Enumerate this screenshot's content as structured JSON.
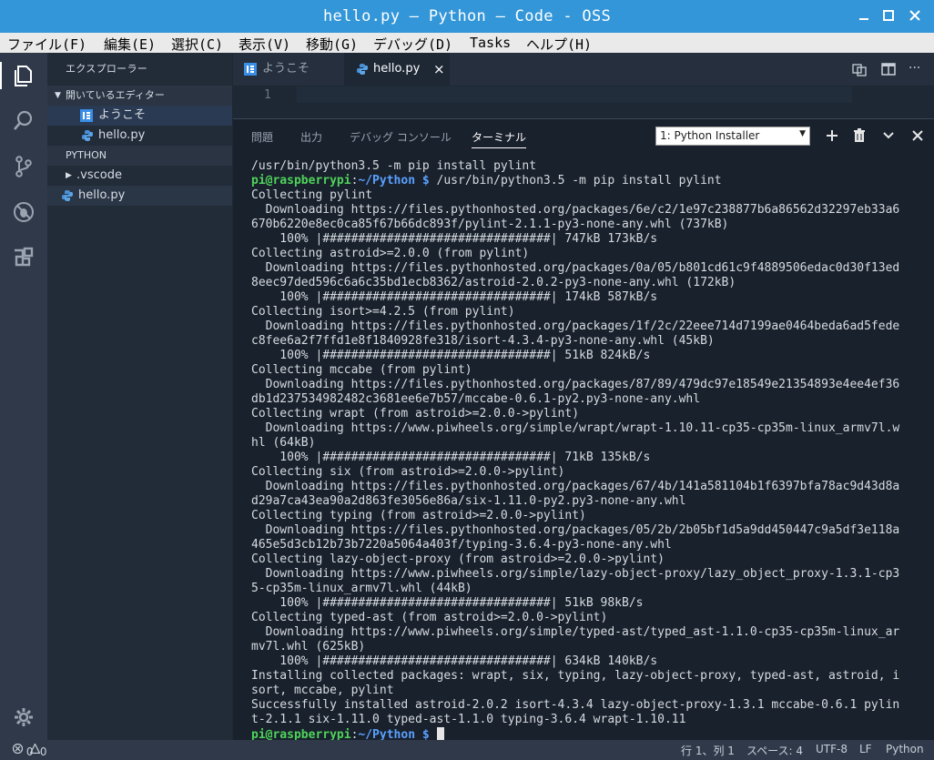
{
  "window": {
    "title": "hello.py — Python — Code - OSS"
  },
  "menu": [
    "ファイル(F)",
    "編集(E)",
    "選択(C)",
    "表示(V)",
    "移動(G)",
    "デバッグ(D)",
    "Tasks",
    "ヘルプ(H)"
  ],
  "sidebar": {
    "title": "エクスプローラー",
    "open_editors_header": "開いているエディター",
    "open_editors": [
      "ようこそ",
      "hello.py"
    ],
    "folder_header": "PYTHON",
    "files": [
      ".vscode",
      "hello.py"
    ]
  },
  "tabs": [
    {
      "label": "ようこそ"
    },
    {
      "label": "hello.py",
      "close": "×"
    }
  ],
  "editor": {
    "line_number": "1"
  },
  "panel": {
    "tabs": [
      "問題",
      "出力",
      "デバッグ コンソール",
      "ターミナル"
    ],
    "terminal_select": "1: Python Installer"
  },
  "terminal": {
    "first_line": "/usr/bin/python3.5 -m pip install pylint",
    "prompt_user": "pi@raspberrypi",
    "prompt_sep": ":",
    "prompt_path": "~/Python $",
    "command": " /usr/bin/python3.5 -m pip install pylint",
    "output": "Collecting pylint\n  Downloading https://files.pythonhosted.org/packages/6e/c2/1e97c238877b6a86562d32297eb33a6\n670b6220e8ec0ca85f67b66dc893f/pylint-2.1.1-py3-none-any.whl (737kB)\n    100% |################################| 747kB 173kB/s\nCollecting astroid>=2.0.0 (from pylint)\n  Downloading https://files.pythonhosted.org/packages/0a/05/b801cd61c9f4889506edac0d30f13ed\n8eec97ded596c6a6c35bd1ecb8362/astroid-2.0.2-py3-none-any.whl (172kB)\n    100% |################################| 174kB 587kB/s\nCollecting isort>=4.2.5 (from pylint)\n  Downloading https://files.pythonhosted.org/packages/1f/2c/22eee714d7199ae0464beda6ad5fede\nc8fee6a2f7ffd1e8f1840928fe318/isort-4.3.4-py3-none-any.whl (45kB)\n    100% |################################| 51kB 824kB/s\nCollecting mccabe (from pylint)\n  Downloading https://files.pythonhosted.org/packages/87/89/479dc97e18549e21354893e4ee4ef36\ndb1d237534982482c3681ee6e7b57/mccabe-0.6.1-py2.py3-none-any.whl\nCollecting wrapt (from astroid>=2.0.0->pylint)\n  Downloading https://www.piwheels.org/simple/wrapt/wrapt-1.10.11-cp35-cp35m-linux_armv7l.w\nhl (64kB)\n    100% |################################| 71kB 135kB/s\nCollecting six (from astroid>=2.0.0->pylint)\n  Downloading https://files.pythonhosted.org/packages/67/4b/141a581104b1f6397bfa78ac9d43d8a\nd29a7ca43ea90a2d863fe3056e86a/six-1.11.0-py2.py3-none-any.whl\nCollecting typing (from astroid>=2.0.0->pylint)\n  Downloading https://files.pythonhosted.org/packages/05/2b/2b05bf1d5a9dd450447c9a5df3e118a\n465e5d3cb12b73b7220a5064a403f/typing-3.6.4-py3-none-any.whl\nCollecting lazy-object-proxy (from astroid>=2.0.0->pylint)\n  Downloading https://www.piwheels.org/simple/lazy-object-proxy/lazy_object_proxy-1.3.1-cp3\n5-cp35m-linux_armv7l.whl (44kB)\n    100% |################################| 51kB 98kB/s\nCollecting typed-ast (from astroid>=2.0.0->pylint)\n  Downloading https://www.piwheels.org/simple/typed-ast/typed_ast-1.1.0-cp35-cp35m-linux_ar\nmv7l.whl (625kB)\n    100% |################################| 634kB 140kB/s\nInstalling collected packages: wrapt, six, typing, lazy-object-proxy, typed-ast, astroid, i\nsort, mccabe, pylint\nSuccessfully installed astroid-2.0.2 isort-4.3.4 lazy-object-proxy-1.3.1 mccabe-0.6.1 pylin\nt-2.1.1 six-1.11.0 typed-ast-1.1.0 typing-3.6.4 wrapt-1.10.11",
    "final_prompt_path": "~/Python $"
  },
  "status": {
    "errors": "0",
    "warnings": "0",
    "position": "行 1、列 1",
    "spaces": "スペース: 4",
    "encoding": "UTF-8",
    "eol": "LF",
    "language": "Python"
  },
  "colors": {
    "titlebar": "#3396d8",
    "accent": "#4fd35a",
    "path": "#5aa0ff"
  }
}
